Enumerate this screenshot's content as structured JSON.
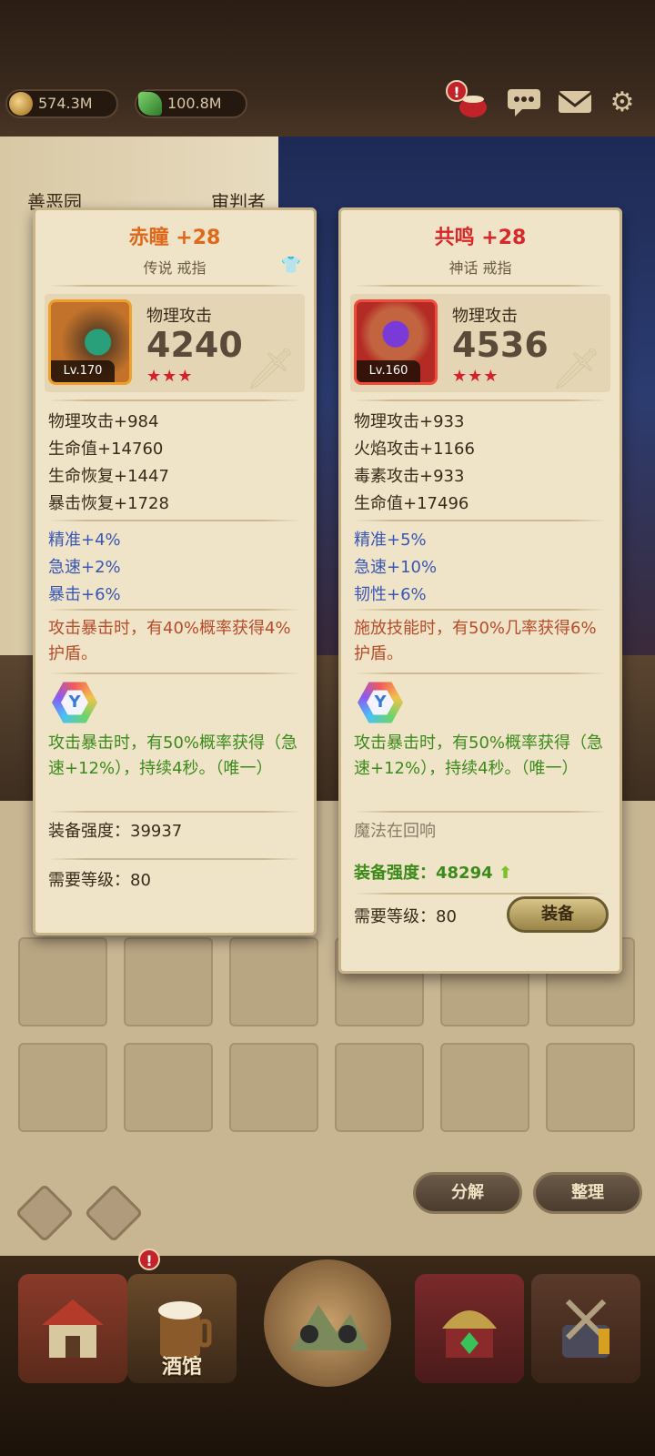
{
  "resources": {
    "coins": "574.3M",
    "gems": "100.8M"
  },
  "top_icons": [
    "pot-icon",
    "chat-icon",
    "mail-icon",
    "gear-icon"
  ],
  "background": {
    "left_text_1": "善恶园",
    "left_text_2": "审判者"
  },
  "item_left": {
    "name": "赤瞳 +28",
    "name_color": "#e0681a",
    "type": "传说 戒指",
    "icon_level": "Lv.170",
    "main_stat_label": "物理攻击",
    "main_stat_value": "4240",
    "stars": "★★★",
    "base_stats": [
      "物理攻击+984",
      "生命值+14760",
      "生命恢复+1447",
      "暴击恢复+1728"
    ],
    "bonus_stats": [
      "精准+4%",
      "急速+2%",
      "暴击+6%"
    ],
    "effect": "攻击暴击时，有40%概率获得4%护盾。",
    "gem_effect": "攻击暴击时，有50%概率获得（急速+12%），持续4秒。（唯一）",
    "power": "装备强度：39937",
    "required_level": "需要等级：80"
  },
  "item_right": {
    "name": "共鸣 +28",
    "name_color": "#d8282a",
    "type": "神话 戒指",
    "icon_level": "Lv.160",
    "main_stat_label": "物理攻击",
    "main_stat_value": "4536",
    "stars": "★★★",
    "base_stats": [
      "物理攻击+933",
      "火焰攻击+1166",
      "毒素攻击+933",
      "生命值+17496"
    ],
    "bonus_stats": [
      "精准+5%",
      "急速+10%",
      "韧性+6%"
    ],
    "effect": "施放技能时，有50%几率获得6%护盾。",
    "gem_effect": "攻击暴击时，有50%概率获得（急速+12%），持续4秒。（唯一）",
    "magic_echo": "魔法在回响",
    "power": "装备强度：48294",
    "required_level": "需要等级：80",
    "equip_label": "装备"
  },
  "buttons": {
    "decompose": "分解",
    "sort": "整理"
  },
  "nav": {
    "tavern": "酒馆"
  }
}
